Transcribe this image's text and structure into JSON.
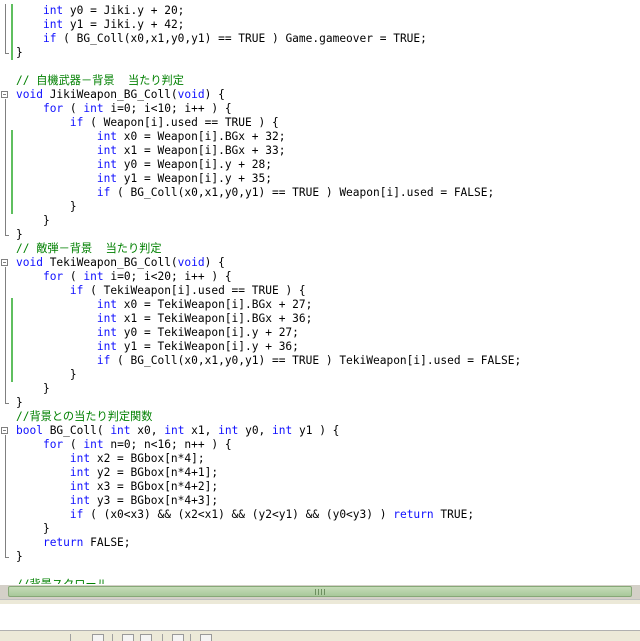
{
  "colors": {
    "keyword": "#1010ff",
    "comment": "#008000",
    "plain": "#000000"
  },
  "code_lines": [
    {
      "tokens": [
        {
          "t": "    "
        },
        {
          "t": "int",
          "k": "kw"
        },
        {
          "t": " y0 = Jiki.y + 20;"
        }
      ]
    },
    {
      "tokens": [
        {
          "t": "    "
        },
        {
          "t": "int",
          "k": "kw"
        },
        {
          "t": " y1 = Jiki.y + 42;"
        }
      ]
    },
    {
      "tokens": [
        {
          "t": "    "
        },
        {
          "t": "if",
          "k": "kw"
        },
        {
          "t": " ( BG_Coll(x0,x1,y0,y1) == TRUE ) Game.gameover = TRUE;"
        }
      ]
    },
    {
      "tokens": [
        {
          "t": "}"
        }
      ]
    },
    {
      "tokens": []
    },
    {
      "tokens": [
        {
          "t": "// 自機武器－背景  当たり判定",
          "k": "cm"
        }
      ]
    },
    {
      "tokens": [
        {
          "t": "void",
          "k": "kw"
        },
        {
          "t": " JikiWeapon_BG_Coll("
        },
        {
          "t": "void",
          "k": "kw"
        },
        {
          "t": ") {"
        }
      ]
    },
    {
      "tokens": [
        {
          "t": "    "
        },
        {
          "t": "for",
          "k": "kw"
        },
        {
          "t": " ( "
        },
        {
          "t": "int",
          "k": "kw"
        },
        {
          "t": " i=0; i<10; i++ ) {"
        }
      ]
    },
    {
      "tokens": [
        {
          "t": "        "
        },
        {
          "t": "if",
          "k": "kw"
        },
        {
          "t": " ( Weapon[i].used == TRUE ) {"
        }
      ]
    },
    {
      "tokens": [
        {
          "t": "            "
        },
        {
          "t": "int",
          "k": "kw"
        },
        {
          "t": " x0 = Weapon[i].BGx + 32;"
        }
      ]
    },
    {
      "tokens": [
        {
          "t": "            "
        },
        {
          "t": "int",
          "k": "kw"
        },
        {
          "t": " x1 = Weapon[i].BGx + 33;"
        }
      ]
    },
    {
      "tokens": [
        {
          "t": "            "
        },
        {
          "t": "int",
          "k": "kw"
        },
        {
          "t": " y0 = Weapon[i].y + 28;"
        }
      ]
    },
    {
      "tokens": [
        {
          "t": "            "
        },
        {
          "t": "int",
          "k": "kw"
        },
        {
          "t": " y1 = Weapon[i].y + 35;"
        }
      ]
    },
    {
      "tokens": [
        {
          "t": "            "
        },
        {
          "t": "if",
          "k": "kw"
        },
        {
          "t": " ( BG_Coll(x0,x1,y0,y1) == TRUE ) Weapon[i].used = FALSE;"
        }
      ]
    },
    {
      "tokens": [
        {
          "t": "        }"
        }
      ]
    },
    {
      "tokens": [
        {
          "t": "    }"
        }
      ]
    },
    {
      "tokens": [
        {
          "t": "}"
        }
      ]
    },
    {
      "tokens": [
        {
          "t": "// 敵弾－背景  当たり判定",
          "k": "cm"
        }
      ]
    },
    {
      "tokens": [
        {
          "t": "void",
          "k": "kw"
        },
        {
          "t": " TekiWeapon_BG_Coll("
        },
        {
          "t": "void",
          "k": "kw"
        },
        {
          "t": ") {"
        }
      ]
    },
    {
      "tokens": [
        {
          "t": "    "
        },
        {
          "t": "for",
          "k": "kw"
        },
        {
          "t": " ( "
        },
        {
          "t": "int",
          "k": "kw"
        },
        {
          "t": " i=0; i<20; i++ ) {"
        }
      ]
    },
    {
      "tokens": [
        {
          "t": "        "
        },
        {
          "t": "if",
          "k": "kw"
        },
        {
          "t": " ( TekiWeapon[i].used == TRUE ) {"
        }
      ]
    },
    {
      "tokens": [
        {
          "t": "            "
        },
        {
          "t": "int",
          "k": "kw"
        },
        {
          "t": " x0 = TekiWeapon[i].BGx + 27;"
        }
      ]
    },
    {
      "tokens": [
        {
          "t": "            "
        },
        {
          "t": "int",
          "k": "kw"
        },
        {
          "t": " x1 = TekiWeapon[i].BGx + 36;"
        }
      ]
    },
    {
      "tokens": [
        {
          "t": "            "
        },
        {
          "t": "int",
          "k": "kw"
        },
        {
          "t": " y0 = TekiWeapon[i].y + 27;"
        }
      ]
    },
    {
      "tokens": [
        {
          "t": "            "
        },
        {
          "t": "int",
          "k": "kw"
        },
        {
          "t": " y1 = TekiWeapon[i].y + 36;"
        }
      ]
    },
    {
      "tokens": [
        {
          "t": "            "
        },
        {
          "t": "if",
          "k": "kw"
        },
        {
          "t": " ( BG_Coll(x0,x1,y0,y1) == TRUE ) TekiWeapon[i].used = FALSE;"
        }
      ]
    },
    {
      "tokens": [
        {
          "t": "        }"
        }
      ]
    },
    {
      "tokens": [
        {
          "t": "    }"
        }
      ]
    },
    {
      "tokens": [
        {
          "t": "}"
        }
      ]
    },
    {
      "tokens": [
        {
          "t": "//背景との当たり判定関数",
          "k": "cm"
        }
      ]
    },
    {
      "tokens": [
        {
          "t": "bool",
          "k": "kw"
        },
        {
          "t": " BG_Coll( "
        },
        {
          "t": "int",
          "k": "kw"
        },
        {
          "t": " x0, "
        },
        {
          "t": "int",
          "k": "kw"
        },
        {
          "t": " x1, "
        },
        {
          "t": "int",
          "k": "kw"
        },
        {
          "t": " y0, "
        },
        {
          "t": "int",
          "k": "kw"
        },
        {
          "t": " y1 ) {"
        }
      ]
    },
    {
      "tokens": [
        {
          "t": "    "
        },
        {
          "t": "for",
          "k": "kw"
        },
        {
          "t": " ( "
        },
        {
          "t": "int",
          "k": "kw"
        },
        {
          "t": " n=0; n<16; n++ ) {"
        }
      ]
    },
    {
      "tokens": [
        {
          "t": "        "
        },
        {
          "t": "int",
          "k": "kw"
        },
        {
          "t": " x2 = BGbox[n*4];"
        }
      ]
    },
    {
      "tokens": [
        {
          "t": "        "
        },
        {
          "t": "int",
          "k": "kw"
        },
        {
          "t": " y2 = BGbox[n*4+1];"
        }
      ]
    },
    {
      "tokens": [
        {
          "t": "        "
        },
        {
          "t": "int",
          "k": "kw"
        },
        {
          "t": " x3 = BGbox[n*4+2];"
        }
      ]
    },
    {
      "tokens": [
        {
          "t": "        "
        },
        {
          "t": "int",
          "k": "kw"
        },
        {
          "t": " y3 = BGbox[n*4+3];"
        }
      ]
    },
    {
      "tokens": [
        {
          "t": "        "
        },
        {
          "t": "if",
          "k": "kw"
        },
        {
          "t": " ( (x0<x3) && (x2<x1) && (y2<y1) && (y0<y3) ) "
        },
        {
          "t": "return",
          "k": "kw"
        },
        {
          "t": " TRUE;"
        }
      ]
    },
    {
      "tokens": [
        {
          "t": "    }"
        }
      ]
    },
    {
      "tokens": [
        {
          "t": "    "
        },
        {
          "t": "return",
          "k": "kw"
        },
        {
          "t": " FALSE;"
        }
      ]
    },
    {
      "tokens": [
        {
          "t": "}"
        }
      ]
    },
    {
      "tokens": []
    },
    {
      "tokens": [
        {
          "t": "//背景スクロール",
          "k": "cm"
        }
      ]
    }
  ],
  "fold_start_lines": [
    6,
    18,
    30
  ],
  "fold_ranges": [
    [
      0,
      3
    ],
    [
      6,
      16
    ],
    [
      18,
      28
    ],
    [
      30,
      39
    ]
  ],
  "change_bar_ranges": [
    [
      0,
      3
    ],
    [
      9,
      14
    ],
    [
      21,
      26
    ]
  ],
  "scrollbar_grip_icon": "grip-icon",
  "toolbar_icons": [
    "new-file-icon",
    "open-folder-icon",
    "copy-icon",
    "paste-icon",
    "list-icon",
    "window-icon"
  ]
}
